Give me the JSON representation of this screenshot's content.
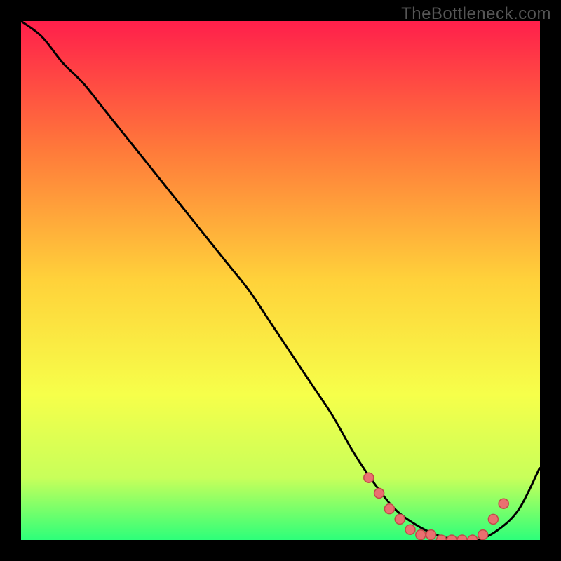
{
  "watermark": "TheBottleneck.com",
  "colors": {
    "background": "#000000",
    "gradient_top": "#ff1f4b",
    "gradient_mid_upper": "#ff7a3a",
    "gradient_mid": "#ffd23a",
    "gradient_mid_lower": "#f6ff4a",
    "gradient_lower": "#c8ff5a",
    "gradient_bottom": "#2dff7a",
    "curve": "#000000",
    "dot_fill": "#e97070",
    "dot_stroke": "#c24a4a"
  },
  "chart_data": {
    "type": "line",
    "title": "",
    "xlabel": "",
    "ylabel": "",
    "xlim": [
      0,
      100
    ],
    "ylim": [
      0,
      100
    ],
    "series": [
      {
        "name": "bottleneck-curve",
        "x": [
          0,
          4,
          8,
          12,
          16,
          20,
          24,
          28,
          32,
          36,
          40,
          44,
          48,
          52,
          56,
          60,
          64,
          68,
          72,
          76,
          80,
          84,
          88,
          92,
          96,
          100
        ],
        "y": [
          100,
          97,
          92,
          88,
          83,
          78,
          73,
          68,
          63,
          58,
          53,
          48,
          42,
          36,
          30,
          24,
          17,
          11,
          6,
          3,
          1,
          0,
          0,
          2,
          6,
          14
        ]
      }
    ],
    "points": {
      "name": "highlighted-dots",
      "x": [
        67,
        69,
        71,
        73,
        75,
        77,
        79,
        81,
        83,
        85,
        87,
        89,
        91,
        93
      ],
      "y": [
        12,
        9,
        6,
        4,
        2,
        1,
        1,
        0,
        0,
        0,
        0,
        1,
        4,
        7
      ]
    }
  }
}
